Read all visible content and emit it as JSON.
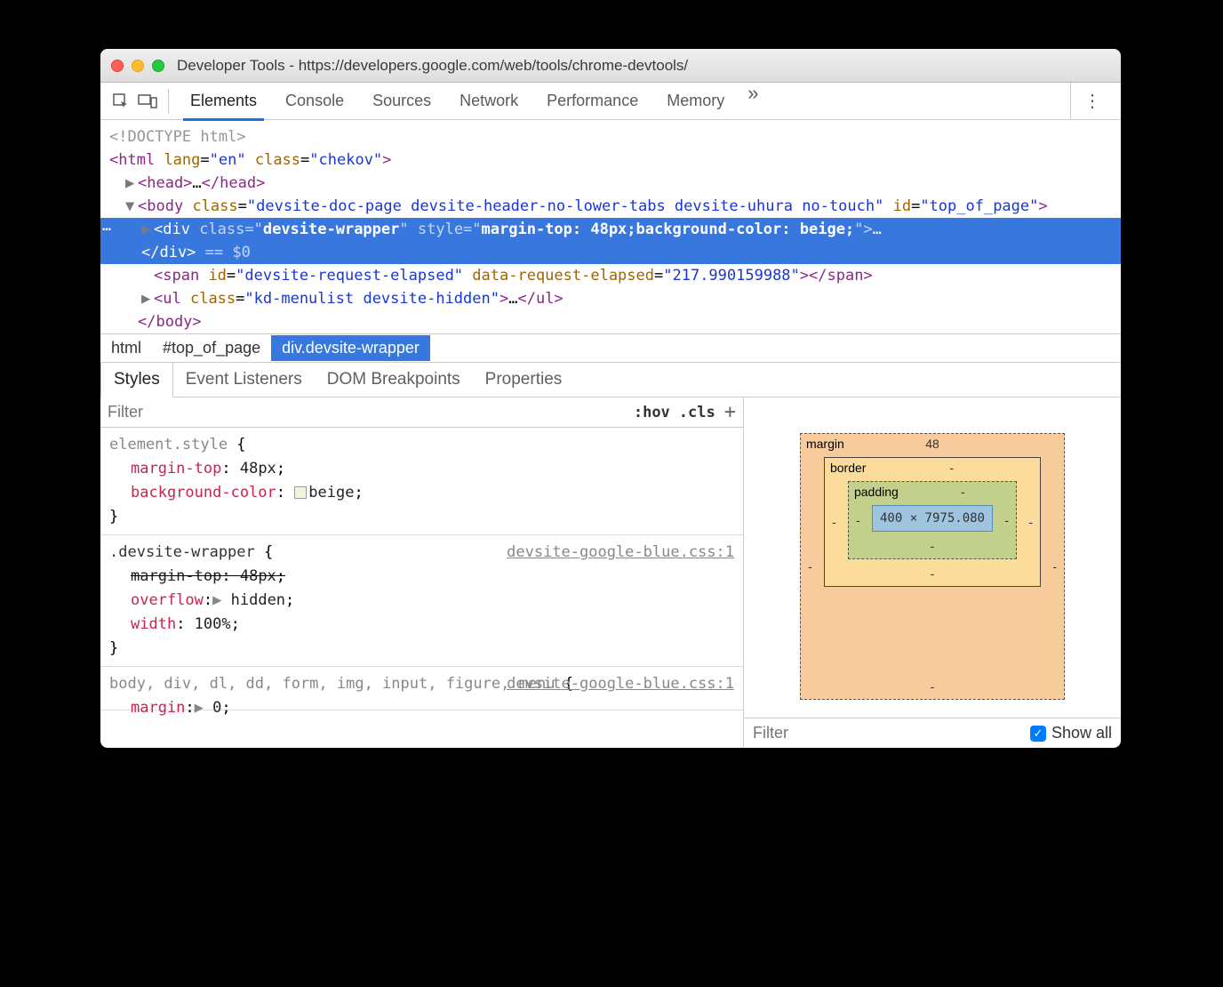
{
  "window": {
    "title": "Developer Tools - https://developers.google.com/web/tools/chrome-devtools/"
  },
  "toolbar": {
    "tabs": [
      "Elements",
      "Console",
      "Sources",
      "Network",
      "Performance",
      "Memory"
    ],
    "more": "»"
  },
  "dom": {
    "doctype": "<!DOCTYPE html>",
    "html_open": "<html lang=\"en\" class=\"chekov\">",
    "head": "<head>…</head>",
    "body_open": "<body class=\"devsite-doc-page devsite-header-no-lower-tabs devsite-uhura no-touch\" id=\"top_of_page\">",
    "selected": "<div class=\"devsite-wrapper\" style=\"margin-top: 48px;background-color: beige;\">…</div> == $0",
    "span": "<span id=\"devsite-request-elapsed\" data-request-elapsed=\"217.990159988\"></span>",
    "ul": "<ul class=\"kd-menulist devsite-hidden\">…</ul>",
    "body_close": "</body>"
  },
  "breadcrumb": [
    "html",
    "#top_of_page",
    "div.devsite-wrapper"
  ],
  "subtabs": [
    "Styles",
    "Event Listeners",
    "DOM Breakpoints",
    "Properties"
  ],
  "filter": {
    "placeholder": "Filter",
    "hov": ":hov",
    "cls": ".cls"
  },
  "rules": [
    {
      "selector": "element.style",
      "props": [
        {
          "name": "margin-top",
          "value": "48px"
        },
        {
          "name": "background-color",
          "value": "beige",
          "swatch": true
        }
      ]
    },
    {
      "selector": ".devsite-wrapper",
      "source": "devsite-google-blue.css:1",
      "props": [
        {
          "name": "margin-top",
          "value": "48px",
          "strike": true
        },
        {
          "name": "overflow",
          "value": "hidden",
          "caret": true
        },
        {
          "name": "width",
          "value": "100%"
        }
      ]
    },
    {
      "selector": "body, div, dl, dd, form, img, input, figure, menu",
      "source": "devsite-google-blue.css:1",
      "props": [
        {
          "name": "margin",
          "value": "0",
          "caret": true,
          "cut": true
        }
      ]
    }
  ],
  "boxModel": {
    "margin": {
      "label": "margin",
      "top": "48",
      "sides": "-",
      "bottom": "-"
    },
    "border": {
      "label": "border",
      "all": "-"
    },
    "padding": {
      "label": "padding",
      "all": "-"
    },
    "content": "400 × 7975.080"
  },
  "bottomFilter": {
    "placeholder": "Filter",
    "showAll": "Show all"
  }
}
